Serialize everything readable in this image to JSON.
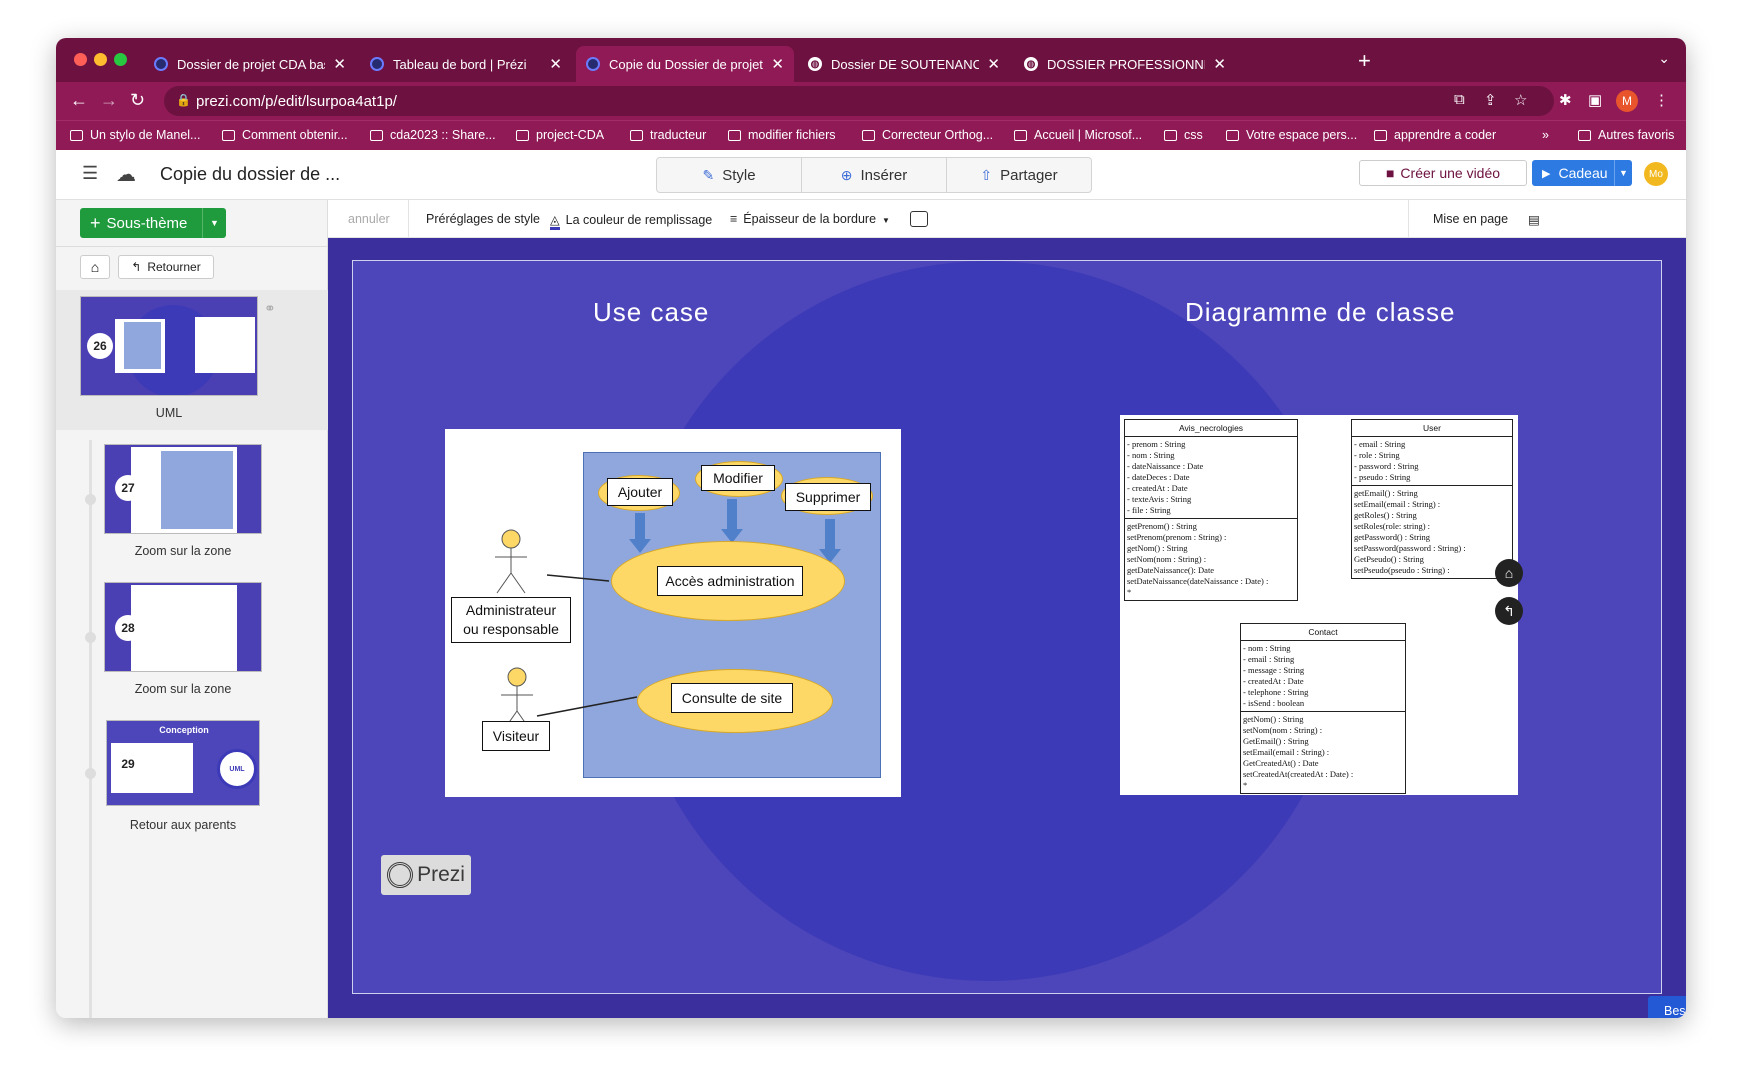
{
  "browser": {
    "tabs": [
      {
        "label": "Dossier de projet CDA bastien",
        "icon": "prezi-icon"
      },
      {
        "label": "Tableau de bord | Prézi",
        "icon": "prezi-icon"
      },
      {
        "label": "Copie du Dossier de projet CDA",
        "icon": "prezi-icon",
        "active": true
      },
      {
        "label": "Dossier DE SOUTENANCE POUR",
        "icon": "globe-icon"
      },
      {
        "label": "DOSSIER PROFESSIONNEL (DP",
        "icon": "globe-icon"
      }
    ],
    "url": "prezi.com/p/edit/lsurpoa4at1p/",
    "profile_initial": "M",
    "bookmarks": [
      "Un stylo de Manel...",
      "Comment obtenir...",
      "cda2023 :: Share...",
      "project-CDA",
      "traducteur",
      "modifier fichiers",
      "Correcteur Orthog...",
      "Accueil | Microsof...",
      "css",
      "Votre espace pers...",
      "apprendre a coder"
    ],
    "bookmarks_more": "»",
    "other_bookmarks": "Autres favoris"
  },
  "app": {
    "doc_title": "Copie du dossier de ...",
    "center_buttons": {
      "style": "Style",
      "insert": "Insérer",
      "share": "Partager"
    },
    "video_button": "Créer une vidéo",
    "gift_button": "Cadeau",
    "user_initials": "Mo"
  },
  "sidebar": {
    "subtheme_button": "Sous-thème",
    "back_button": "Retourner",
    "slides": [
      {
        "number": "26",
        "label": "UML"
      },
      {
        "number": "27",
        "label": "Zoom sur la zone"
      },
      {
        "number": "28",
        "label": "Zoom sur la zone"
      },
      {
        "number": "29",
        "label": "Retour aux parents",
        "title": "Conception",
        "circle_text": "UML"
      }
    ]
  },
  "toolbar": {
    "undo": "annuler",
    "style_presets": "Préréglages de style",
    "fill_color": "La couleur de remplissage",
    "border_thickness": "Épaisseur de la bordure",
    "layout": "Mise en page"
  },
  "canvas": {
    "use_case_title": "Use case",
    "class_diagram_title": "Diagramme de classe",
    "use_case": {
      "ajouter": "Ajouter",
      "modifier": "Modifier",
      "supprimer": "Supprimer",
      "acces": "Accès administration",
      "consulte": "Consulte de site",
      "admin_line1": "Administrateur",
      "admin_line2": "ou responsable",
      "visiteur": "Visiteur"
    },
    "classes": {
      "avis": {
        "name": "Avis_necrologies",
        "attributes": [
          "- prenom : String",
          "- nom : String",
          "- dateNaissance : Date",
          "- dateDeces : Date",
          "- createdAt : Date",
          "- texteAvis : String",
          "- file : String"
        ],
        "methods": [
          "getPrenom() : String",
          "setPrenom(prenom : String) :",
          "getNom() : String",
          "setNom(nom : String) :",
          "getDateNaissance(): Date",
          "setDateNaissance(dateNaissance : Date) :",
          "*"
        ]
      },
      "user": {
        "name": "User",
        "attributes": [
          "- email : String",
          "- role : String",
          "- password : String",
          "- pseudo : String"
        ],
        "methods": [
          "getEmail() : String",
          "setEmail(email : String) :",
          "getRoles() : String",
          "setRoles(role: string) :",
          "getPassword() : String",
          "setPassword(password : String) :",
          "GetPseudo() : String",
          "setPseudo(pseudo : String) :"
        ]
      },
      "contact": {
        "name": "Contact",
        "attributes": [
          "- nom : String",
          "- email : String",
          "- message : String",
          "- createdAt : Date",
          "- telephone : String",
          "- isSend : boolean"
        ],
        "methods": [
          "getNom() : String",
          "setNom(nom : String) :",
          "GetEmail() : String",
          "setEmail(email : String) :",
          "GetCreatedAt() : Date",
          "setCreatedAt(createdAt : Date) :",
          "*"
        ]
      }
    },
    "logo_text": "Prezi",
    "help_button": "Besoin d'aide"
  }
}
